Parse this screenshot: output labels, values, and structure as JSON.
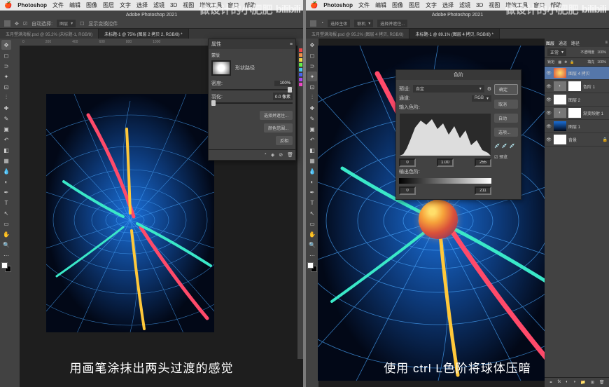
{
  "left": {
    "mac_menu": [
      "Photoshop",
      "文件",
      "编辑",
      "图像",
      "图层",
      "文字",
      "选择",
      "滤镜",
      "3D",
      "视图",
      "增效工具",
      "窗口",
      "帮助"
    ],
    "titlebar": "Adobe Photoshop 2021",
    "options": {
      "home": "⌂",
      "auto_select": "自动选择:",
      "target": "图层",
      "show_transform": "显示变换控件"
    },
    "tabs": [
      {
        "label": "五月塑满海报.psd @ 95.2% (未标题-1, RGB/8)",
        "active": false
      },
      {
        "label": "未标题-1 @ 75% (图层 2 拷贝 2, RGB/8) *",
        "active": true
      }
    ],
    "ruler_values": [
      "0",
      "200",
      "400",
      "600",
      "800",
      "1000",
      "1200",
      "1400"
    ],
    "properties_panel": {
      "title": "属性",
      "mask_heading": "蒙版",
      "mask_label": "形状路径",
      "density_label": "密度:",
      "density_value": "100%",
      "feather_label": "羽化:",
      "feather_value": "0.0 像素",
      "btn1": "选择并遮住...",
      "btn2": "颜色范围...",
      "btn3": "反相"
    },
    "caption": "用画笔涂抹出两头过渡的感觉",
    "watermark": "做设计的小肥肥",
    "logo": "bilibili"
  },
  "right": {
    "mac_menu": [
      "Photoshop",
      "文件",
      "编辑",
      "图像",
      "图层",
      "文字",
      "选择",
      "滤镜",
      "3D",
      "视图",
      "增效工具",
      "窗口",
      "帮助"
    ],
    "titlebar": "Adobe Photoshop 2021",
    "options": {
      "home": "⌂",
      "select_subject": "选择主体",
      "cloud": "联机",
      "mask_btn": "选择并遮住..."
    },
    "tabs": [
      {
        "label": "五月塑满海报.psd @ 95.2% (图层 4 拷贝, RGB/8)",
        "active": false
      },
      {
        "label": "未标题-1 @ 89.1% (图层 4 拷贝, RGB/8) *",
        "active": true
      }
    ],
    "levels_panel": {
      "title": "色阶",
      "preset_label": "预设:",
      "preset_value": "自定",
      "channel_label": "通道:",
      "channel_value": "RGB",
      "input_label": "输入色阶:",
      "inputs": {
        "black": "0",
        "mid": "1.00",
        "white": "255"
      },
      "output_label": "输出色阶:",
      "outputs": {
        "black": "0",
        "white": "211"
      },
      "btn_ok": "确定",
      "btn_cancel": "取消",
      "btn_auto": "自动",
      "btn_options": "选项...",
      "preview": "预览"
    },
    "layers_panel": {
      "tabs": [
        "图层",
        "通道",
        "路径"
      ],
      "blend": "正常",
      "opacity_label": "不透明度",
      "opacity": "100%",
      "lock_label": "锁定:",
      "fill_label": "填充",
      "fill": "100%",
      "layers": [
        {
          "name": "图层 4 拷贝",
          "sel": true,
          "thumb": "sphere"
        },
        {
          "name": "色阶 1",
          "thumb": "adj"
        },
        {
          "name": "图层 2",
          "thumb": "white"
        },
        {
          "name": "渐变映射 1",
          "thumb": "adj"
        },
        {
          "name": "图层 1",
          "thumb": "bg"
        },
        {
          "name": "背景",
          "thumb": "bg"
        }
      ]
    },
    "caption": "使用 ctrl L色阶将球体压暗",
    "watermark": "做设计的小肥肥",
    "logo": "bilibili"
  }
}
